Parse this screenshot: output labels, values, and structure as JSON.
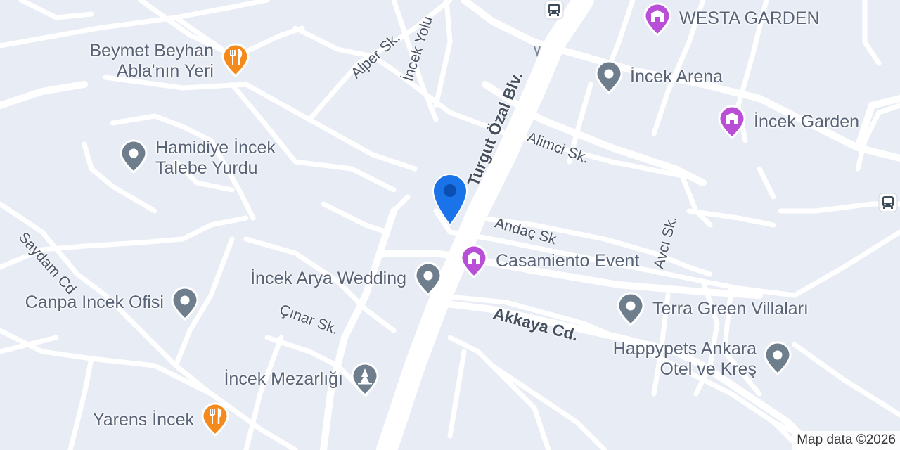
{
  "colors": {
    "background": "#e8ecf4",
    "road": "#ffffff",
    "poi_gray": "#6e7e8c",
    "poi_food": "#f48a1c",
    "poi_event": "#b84fd6",
    "user_pin": "#1a73e8",
    "bus_stop": "#3d4a5a"
  },
  "streets": {
    "alper": "Alper Sk.",
    "incek_yolu": "İncek Yolu",
    "turgut_ozal": "Turgut Özal Blv.",
    "alimci": "Alimci Sk.",
    "andac": "Andaç Sk",
    "avci": "Avcı Sk.",
    "saydam": "Saydam Cd",
    "cinar": "Çınar Sk.",
    "akkaya": "Akkaya Cd."
  },
  "pois": {
    "westa_garden": {
      "name": "WESTA GARDEN",
      "icon": "event-venue-icon"
    },
    "beymet_line1": "Beymet Beyhan",
    "beymet_line2": "Abla'nın Yeri",
    "beymet_icon": "restaurant-icon",
    "incek_arena": {
      "name": "İncek Arena",
      "icon": "place-icon"
    },
    "incek_garden": {
      "name": "İncek Garden",
      "icon": "event-venue-icon"
    },
    "hamidiye_line1": "Hamidiye İncek",
    "hamidiye_line2": "Talebe Yurdu",
    "hamidiye_icon": "place-icon",
    "casamiento": {
      "name": "Casamiento Event",
      "icon": "event-venue-icon"
    },
    "arya_wedding": {
      "name": "İncek Arya Wedding",
      "icon": "place-icon"
    },
    "canpa": {
      "name": "Canpa Incek Ofisi",
      "icon": "place-icon"
    },
    "terra_green": {
      "name": "Terra Green Villaları",
      "icon": "place-icon"
    },
    "happypets_line1": "Happypets Ankara",
    "happypets_line2": "Otel ve Kreş",
    "happypets_icon": "place-icon",
    "mezarligi": {
      "name": "İncek Mezarlığı",
      "icon": "cemetery-icon"
    },
    "yarens": {
      "name": "Yarens İncek",
      "icon": "restaurant-icon"
    }
  },
  "bus_stops": [
    "bus-stop-icon",
    "bus-stop-icon"
  ],
  "attribution": "Map data ©2026"
}
